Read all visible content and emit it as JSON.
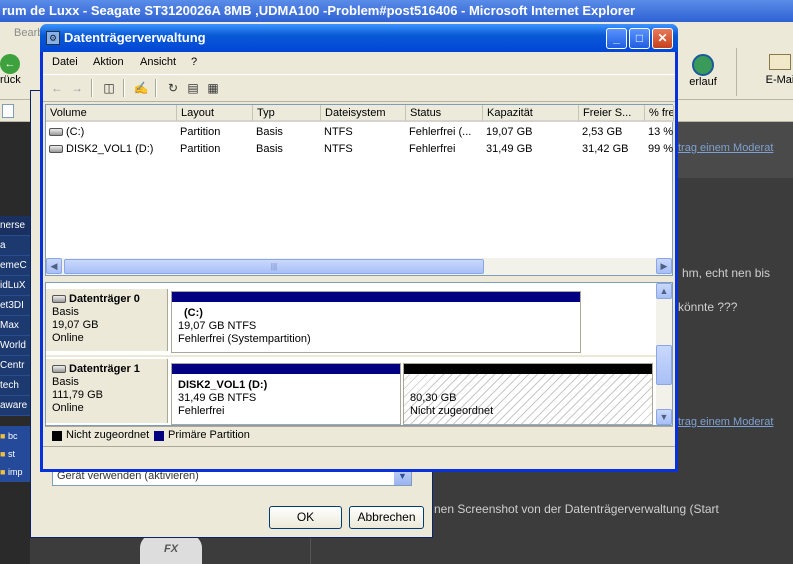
{
  "ie": {
    "title": "rum de Luxx - Seagate ST3120026A 8MB ,UDMA100 -Problem#post516406 - Microsoft Internet Explorer",
    "menu_partial": "Bearb",
    "back_label": "rück",
    "history_label": "erlauf",
    "email_label": "E-Mai",
    "forum_link_1": "trag einem Moderat",
    "forum_link_2": "trag einem Moderat",
    "post_text_1": "hm, echt nen bis",
    "post_text_2": "könnte ???",
    "post_text_3": "nen Screenshot von der Datenträgerverwaltung (Start",
    "sidebar": [
      "nerse",
      "a",
      "emeC",
      "idLuX",
      "et3DI",
      "Max",
      "World",
      "Centr",
      "tech",
      "aware"
    ],
    "tree_items": [
      "bc",
      "st",
      "imp"
    ],
    "fx_label": "FX"
  },
  "bg_dialog": {
    "select_value": "Gerät verwenden (aktivieren)",
    "ok_label": "OK",
    "cancel_label": "Abbrechen"
  },
  "mmc": {
    "title": "Datenträgerverwaltung",
    "menu": [
      "Datei",
      "Aktion",
      "Ansicht",
      "?"
    ],
    "columns": [
      "Volume",
      "Layout",
      "Typ",
      "Dateisystem",
      "Status",
      "Kapazität",
      "Freier S...",
      "% fre"
    ],
    "volumes": [
      {
        "volume": "(C:)",
        "layout": "Partition",
        "type": "Basis",
        "fs": "NTFS",
        "status": "Fehlerfrei (...",
        "capacity": "19,07 GB",
        "free": "2,53 GB",
        "pct": "13 %"
      },
      {
        "volume": "DISK2_VOL1 (D:)",
        "layout": "Partition",
        "type": "Basis",
        "fs": "NTFS",
        "status": "Fehlerfrei",
        "capacity": "31,49 GB",
        "free": "31,42 GB",
        "pct": "99 %"
      }
    ],
    "disks": [
      {
        "name": "Datenträger 0",
        "type": "Basis",
        "size": "19,07 GB",
        "state": "Online",
        "partitions": [
          {
            "label": "(C:)",
            "size_fs": "19,07 GB NTFS",
            "status": "Fehlerfrei (Systempartition)"
          }
        ]
      },
      {
        "name": "Datenträger 1",
        "type": "Basis",
        "size": "111,79 GB",
        "state": "Online",
        "partitions": [
          {
            "label": "DISK2_VOL1  (D:)",
            "size_fs": "31,49 GB NTFS",
            "status": "Fehlerfrei"
          },
          {
            "label": "",
            "size_fs": "80,30 GB",
            "status": "Nicht zugeordnet"
          }
        ]
      }
    ],
    "legend": [
      {
        "label": "Nicht zugeordnet",
        "color": "#000000"
      },
      {
        "label": "Primäre Partition",
        "color": "#000080"
      }
    ]
  },
  "colors": {
    "primary_partition": "#000080",
    "unallocated": "#000000",
    "xp_title_blue": "#0a5ad6"
  }
}
